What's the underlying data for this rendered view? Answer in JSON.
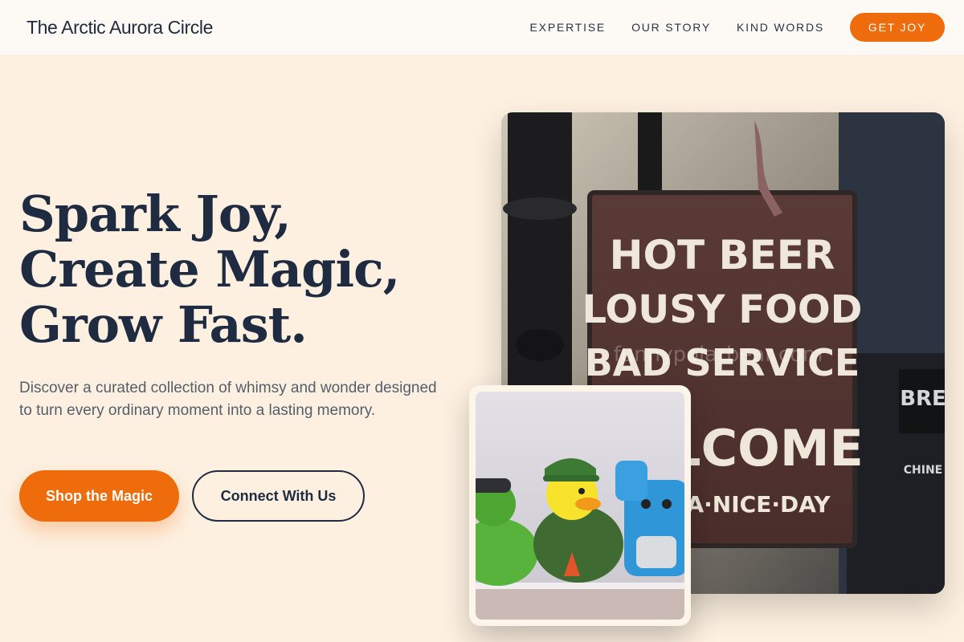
{
  "header": {
    "brand": "The Arctic Aurora Circle",
    "nav": [
      {
        "label": "EXPERTISE"
      },
      {
        "label": "OUR STORY"
      },
      {
        "label": "KIND WORDS"
      }
    ],
    "cta_label": "GET JOY"
  },
  "hero": {
    "title_lines": [
      "Spark Joy,",
      "Create Magic,",
      "Grow Fast."
    ],
    "description": "Discover a curated collection of whimsy and wonder designed to turn every ordinary moment into a lasting memory.",
    "primary_button": "Shop the Magic",
    "secondary_button": "Connect With Us"
  },
  "images": {
    "main_sign_lines": [
      "HOT BEER",
      "LOUSY FOOD",
      "BAD SERVICE",
      "LCOME",
      "A·NICE·DAY"
    ],
    "watermark": "funnypolarbear.com"
  },
  "colors": {
    "accent": "#ef6c0c",
    "background": "#fdf0e0",
    "header_bg": "#fdfaf5",
    "text_dark": "#1f2b40"
  }
}
